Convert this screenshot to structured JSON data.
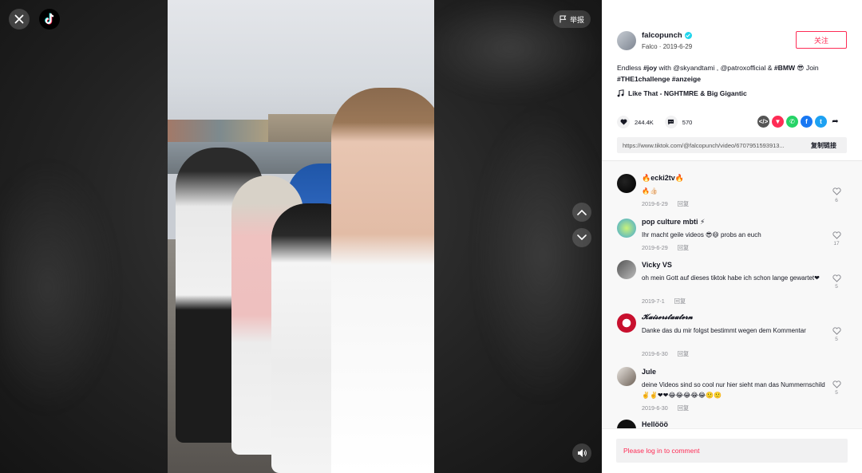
{
  "overlay": {
    "report_label": "举报"
  },
  "author": {
    "username": "falcopunch",
    "display_name": "Falco",
    "date": "2019-6-29",
    "follow_label": "关注"
  },
  "description": {
    "t1": "Endless ",
    "h1": "#joy",
    "t2": " with @skyandtami , @patroxofficial & ",
    "h2": "#BMW",
    "t3": " 😎 Join ",
    "h3": "#THE1challenge",
    "t4": " ",
    "h4": "#anzeige"
  },
  "music": "Like That - NGHTMRE & Big Gigantic",
  "stats": {
    "likes": "244.4K",
    "comments": "570"
  },
  "share_link": {
    "url": "https://www.tiktok.com/@falcopunch/video/6707951593913...",
    "copy_label": "复制链接"
  },
  "comments": [
    {
      "name": "🔥ecki2tv🔥",
      "text": "🔥👍🏻",
      "date": "2019-6-29",
      "reply": "回复",
      "likes": "6"
    },
    {
      "name": "pop culture mbti ⚡",
      "text": "Ihr macht geile videos 😎😄 probs an euch",
      "date": "2019-6-29",
      "reply": "回复",
      "likes": "17"
    },
    {
      "name": "Vicky VS",
      "text": "oh mein Gott auf dieses tiktok habe ich schon lange gewartet❤",
      "date": "2019-7-1",
      "reply": "回复",
      "likes": "5"
    },
    {
      "name": "𝓚𝓪𝓲𝓼𝓮𝓻𝓼𝓽𝓪𝓾𝓽𝓮𝓻𝓷",
      "text": "Danke das du mir folgst bestimmt wegen dem Kommentar",
      "date": "2019-6-30",
      "reply": "回复",
      "likes": "5"
    },
    {
      "name": "Jule",
      "text": "deine Videos sind so cool nur hier sieht man das Nummernschild ✌️✌️❤❤😂😂😂😂😂🙂🙂",
      "date": "2019-6-30",
      "reply": "回复",
      "likes": "5"
    },
    {
      "name": "Hellööö"
    }
  ],
  "login_prompt": "Please log in to comment",
  "colors": {
    "accent": "#fe2c55",
    "verified": "#20d5ec"
  }
}
